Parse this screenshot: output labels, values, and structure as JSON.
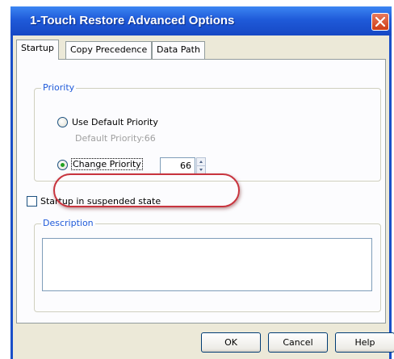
{
  "window": {
    "title": "1-Touch Restore Advanced Options"
  },
  "tabs": [
    {
      "label": "Startup",
      "active": true
    },
    {
      "label": "Copy Precedence",
      "active": false
    },
    {
      "label": "Data Path",
      "active": false
    }
  ],
  "priority": {
    "legend": "Priority",
    "use_default_label": "Use Default Priority",
    "default_hint": "Default Priority:66",
    "change_label": "Change Priority",
    "value": "66",
    "selected": "change"
  },
  "suspended": {
    "label": "Startup in suspended state",
    "checked": false
  },
  "description": {
    "legend": "Description",
    "value": ""
  },
  "buttons": {
    "ok": "OK",
    "cancel": "Cancel",
    "help": "Help"
  },
  "colors": {
    "titlebar": "#1f5ad9",
    "legend_text": "#1f5ad9",
    "highlight_ring": "#c8343e",
    "radio_dot": "#21a121"
  }
}
